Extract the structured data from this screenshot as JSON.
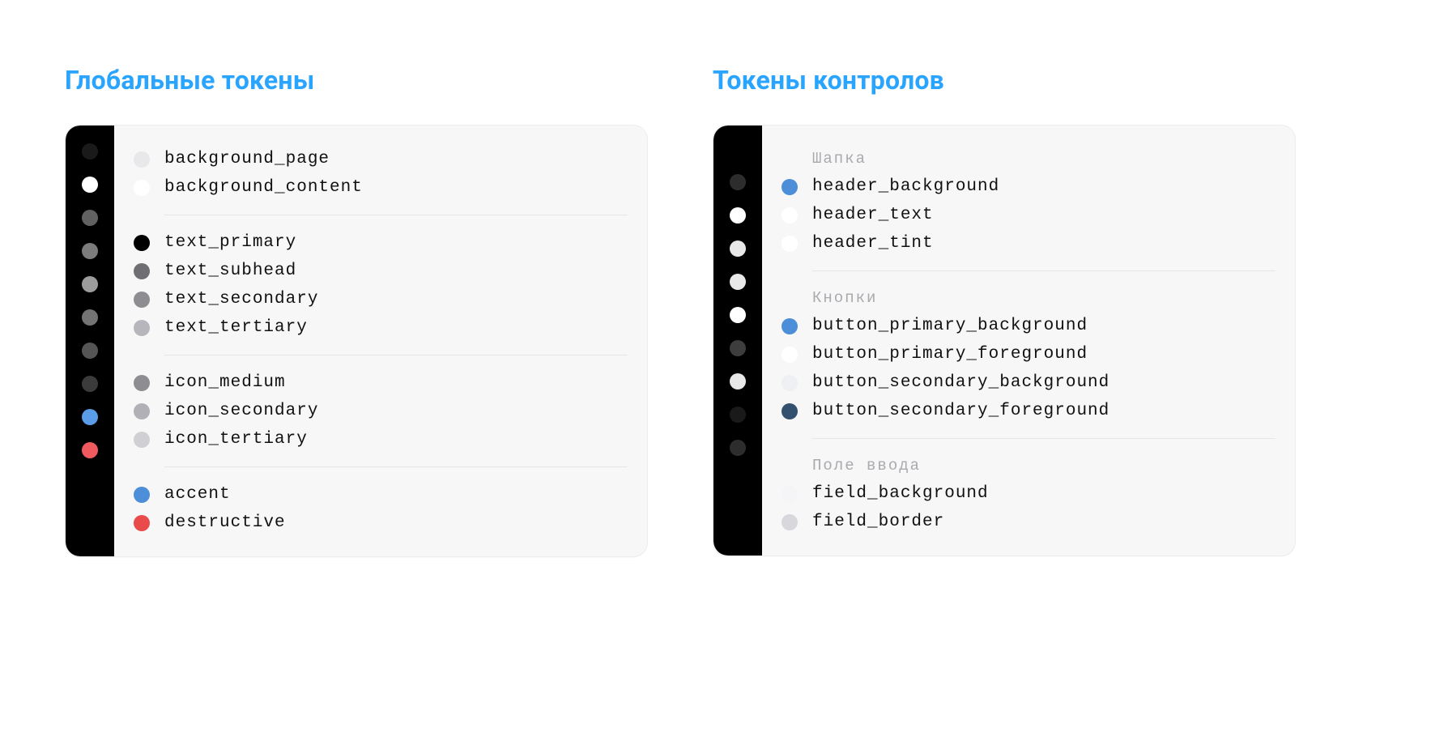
{
  "left": {
    "title": "Глобальные токены",
    "darkSwatches": [
      "#1a1a1a",
      "#ffffff",
      "#616161",
      "#7c7c7c",
      "#9c9c9c",
      "#747474",
      "#555555",
      "#3b3b3b",
      "#5a9ce8",
      "#ef5a5f"
    ],
    "groups": [
      {
        "title": null,
        "items": [
          {
            "swatch": "#e8e8ea",
            "label": "background_page"
          },
          {
            "swatch": "#ffffff",
            "label": "background_content"
          }
        ]
      },
      {
        "title": null,
        "items": [
          {
            "swatch": "#000000",
            "label": "text_primary"
          },
          {
            "swatch": "#6f6f73",
            "label": "text_subhead"
          },
          {
            "swatch": "#8d8d92",
            "label": "text_secondary"
          },
          {
            "swatch": "#b6b6bc",
            "label": "text_tertiary"
          }
        ]
      },
      {
        "title": null,
        "items": [
          {
            "swatch": "#8d8d92",
            "label": "icon_medium"
          },
          {
            "swatch": "#b0b0b6",
            "label": "icon_secondary"
          },
          {
            "swatch": "#cfcfd4",
            "label": "icon_tertiary"
          }
        ]
      },
      {
        "title": null,
        "items": [
          {
            "swatch": "#4c8ed8",
            "label": "accent"
          },
          {
            "swatch": "#e94b4b",
            "label": "destructive"
          }
        ]
      }
    ]
  },
  "right": {
    "title": "Токены контролов",
    "darkSwatches": [
      "#2d2d2d",
      "#ffffff",
      "#e8e8e8",
      "#e8e8e8",
      "#ffffff",
      "#3d3d3d",
      "#e8e8e8",
      "#1a1a1a",
      "#2d2d2d"
    ],
    "groups": [
      {
        "title": "Шапка",
        "items": [
          {
            "swatch": "#4c8ed8",
            "label": "header_background"
          },
          {
            "swatch": "#ffffff",
            "label": "header_text"
          },
          {
            "swatch": "#ffffff",
            "label": "header_tint"
          }
        ]
      },
      {
        "title": "Кнопки",
        "items": [
          {
            "swatch": "#4c8ed8",
            "label": "button_primary_background"
          },
          {
            "swatch": "#ffffff",
            "label": "button_primary_foreground"
          },
          {
            "swatch": "#eef0f3",
            "label": "button_secondary_background"
          },
          {
            "swatch": "#33506e",
            "label": "button_secondary_foreground"
          }
        ]
      },
      {
        "title": "Поле ввода",
        "items": [
          {
            "swatch": "#f5f5f7",
            "label": "field_background"
          },
          {
            "swatch": "#d8d8dc",
            "label": "field_border"
          }
        ]
      }
    ]
  }
}
